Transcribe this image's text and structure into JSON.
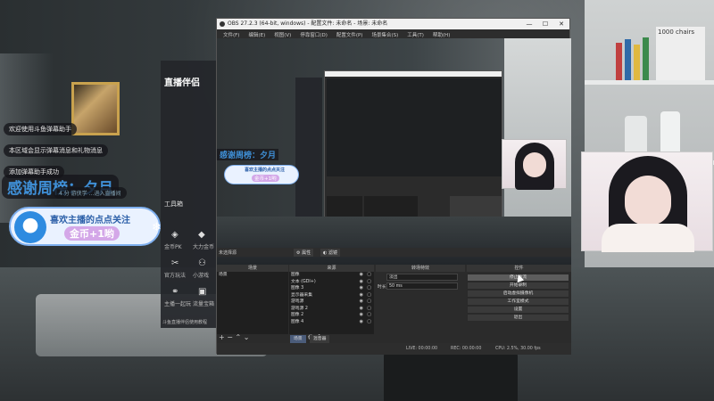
{
  "overlay": {
    "danmu": [
      "欢迎使用斗鱼弹幕助手",
      "本区域会显示弹幕消息和礼物消息",
      "添加弹幕助手成功"
    ],
    "thanks_banner": "感谢周榜：夕月",
    "thanks_sub": "4 分 游侠学 …进入直播间",
    "follow_title": "喜欢主播的点点关注",
    "follow_name": "金币+1哟"
  },
  "helper_app": {
    "logo": "直播伴侣",
    "items": [
      {
        "label": "工具箱"
      },
      {
        "label": "金币PK",
        "icon": "trophy-icon"
      },
      {
        "label": "大力金币",
        "icon": "gift-icon"
      },
      {
        "label": "官方玩法",
        "icon": "tools-icon"
      },
      {
        "label": "小游戏",
        "icon": "game-icon"
      },
      {
        "label": "主播一起玩",
        "icon": "link-icon"
      },
      {
        "label": "流量宝箱",
        "icon": "box-icon"
      }
    ],
    "footer": "斗鱼直播伴侣使用教程"
  },
  "obs": {
    "title": "OBS 27.2.3 (64-bit, windows) - 配置文件: 未命名 - 场景: 未命名",
    "menu": [
      "文件(F)",
      "编辑(E)",
      "视图(V)",
      "停靠窗口(D)",
      "配置文件(P)",
      "场景集合(S)",
      "工具(T)",
      "帮助(H)"
    ],
    "preview_label": "未选择源",
    "properties_btn": "属性",
    "filters_btn": "滤镜",
    "docks": {
      "scenes_header": "场景",
      "scenes": [
        "场景"
      ],
      "sources_header": "来源",
      "sources": [
        "图像",
        "文本 (GDI+)",
        "图像 3",
        "显示器采集",
        "游戏源",
        "游戏源 2",
        "图像 2",
        "图像 4"
      ],
      "transitions_header": "转场特效",
      "transition_type": "淡出",
      "duration_label": "时长",
      "duration_value": "50 ms",
      "controls_header": "控件",
      "controls": [
        "停止推流",
        "开始录制",
        "启动虚拟摄像机",
        "工作室模式",
        "设置",
        "退出"
      ]
    },
    "tabs": [
      "场景",
      "混音器"
    ],
    "status": {
      "live": "LIVE: 00:00:00",
      "rec": "REC: 00:00:00",
      "cpu": "CPU: 2.5%, 30.00 fps"
    },
    "nested": {
      "text": "感谢周榜：夕月",
      "follow_title": "喜欢主播的点点关注",
      "follow_name": "金币+1哟"
    }
  },
  "shelf": {
    "poster": "1000 chairs"
  }
}
